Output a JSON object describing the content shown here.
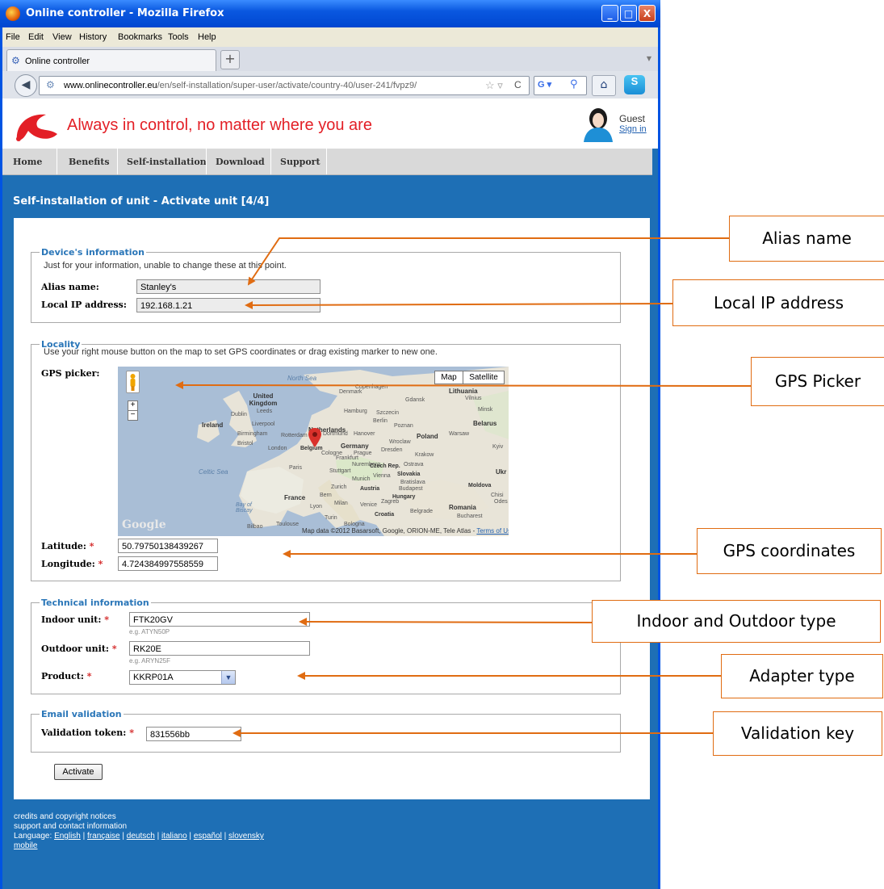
{
  "window": {
    "title": "Online controller - Mozilla Firefox",
    "buttons": [
      "_",
      "□",
      "X"
    ]
  },
  "menu": [
    "File",
    "Edit",
    "View",
    "History",
    "Bookmarks",
    "Tools",
    "Help"
  ],
  "tab": {
    "label": "Online controller",
    "new_tab": "+"
  },
  "address": {
    "url_domain": "www.onlinecontroller.eu",
    "url_path": "/en/self-installation/super-user/activate/country-40/user-241/fvpz9/"
  },
  "site": {
    "slogan": "Always in control, no matter where you are",
    "user": "Guest",
    "sign_in": "Sign in",
    "nav": [
      "Home",
      "Benefits",
      "Self-installation",
      "Download",
      "Support"
    ],
    "page_title": "Self-installation of unit - Activate unit [4/4]"
  },
  "device": {
    "legend": "Device's information",
    "note": "Just for your information, unable to change these at this point.",
    "alias_label": "Alias name:",
    "alias_value": "Stanley's",
    "ip_label": "Local IP address:",
    "ip_value": "192.168.1.21"
  },
  "locality": {
    "legend": "Locality",
    "note": "Use your right mouse button on the map to set GPS coordinates or drag existing marker to new one.",
    "picker_label": "GPS picker:",
    "map_btn": "Map",
    "satellite_btn": "Satellite",
    "map_labels": [
      "North Sea",
      "United Kingdom",
      "Ireland",
      "Dublin",
      "Leeds",
      "Liverpool",
      "Birmingham",
      "Bristol",
      "London",
      "Celtic Sea",
      "Netherlands",
      "Rotterdam",
      "Belgium",
      "Paris",
      "France",
      "Bay of Biscay",
      "Toulouse",
      "Bilbao",
      "Germany",
      "Hamburg",
      "Berlin",
      "Dortmund",
      "Hanover",
      "Cologne",
      "Frankfurt",
      "Stuttgart",
      "Nuremberg",
      "Munich",
      "Prague",
      "Czech Rep.",
      "Dresden",
      "Szczecin",
      "Poznan",
      "Wroclaw",
      "Krakow",
      "Ostrava",
      "Slovakia",
      "Vienna",
      "Bratislava",
      "Budapest",
      "Hungary",
      "Austria",
      "Zurich",
      "Bern",
      "Lyon",
      "Milan",
      "Venice",
      "Turin",
      "Bologna",
      "Zagreb",
      "Croatia",
      "Belgrade",
      "Romania",
      "Bucharest",
      "Moldova",
      "Poland",
      "Warsaw",
      "Gdansk",
      "Lithuania",
      "Vilnius",
      "Copenhagen",
      "Denmark",
      "Belarus",
      "Minsk",
      "Ukr",
      "Kyiv",
      "Odes",
      "Chisi"
    ],
    "map_attribution": "Map data ©2012 Basarsoft, Google, ORION-ME, Tele Atlas",
    "terms": "Terms of Use",
    "google": "Google",
    "lat_label": "Latitude:",
    "lat_value": "50.79750138439267",
    "lon_label": "Longitude:",
    "lon_value": "4.724384997558559"
  },
  "technical": {
    "legend": "Technical information",
    "indoor_label": "Indoor unit:",
    "indoor_value": "FTK20GV",
    "indoor_hint": "e.g. ATYN50P",
    "outdoor_label": "Outdoor unit:",
    "outdoor_value": "RK20E",
    "outdoor_hint": "e.g. ARYN25F",
    "product_label": "Product:",
    "product_value": "KKRP01A"
  },
  "email": {
    "legend": "Email validation",
    "token_label": "Validation token:",
    "token_value": "831556bb"
  },
  "activate_label": "Activate",
  "footer": {
    "line1": "credits and copyright notices",
    "line2": "support and contact information",
    "lang_prefix": "Language:",
    "languages": [
      "English",
      "française",
      "deutsch",
      "italiano",
      "español",
      "slovensky"
    ],
    "mobile": "mobile"
  },
  "annotations": {
    "alias": "Alias name",
    "ip": "Local IP address",
    "gps_picker": "GPS Picker",
    "gps_coords": "GPS coordinates",
    "unit_type": "Indoor and Outdoor type",
    "adapter": "Adapter type",
    "validation": "Validation key"
  },
  "colors": {
    "accent": "#e06c12",
    "brand_red": "#e31f26",
    "page_blue": "#1e6fb5",
    "legend_blue": "#2a76b8"
  }
}
